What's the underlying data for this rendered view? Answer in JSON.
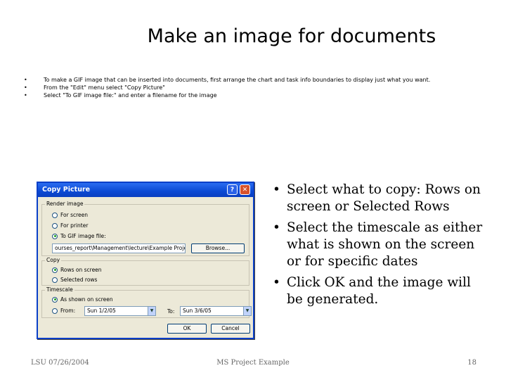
{
  "slide": {
    "title": "Make an image for documents",
    "small_bullets": [
      "To make a GIF image that can be inserted into documents, first arrange the chart and task info boundaries to display just what you want.",
      "From the \"Edit\" menu select \"Copy Picture\"",
      "Select \"To GIF image file:\" and enter a filename for the image"
    ],
    "bullets": [
      "Select what to copy: Rows on screen or Selected Rows",
      "Select the timescale as either what is shown on the screen or for specific dates",
      "Click OK and the image will be generated."
    ],
    "footer": {
      "left": "LSU 07/26/2004",
      "center": "MS Project Example",
      "right": "18"
    }
  },
  "dialog": {
    "title": "Copy Picture",
    "help_glyph": "?",
    "close_glyph": "✕",
    "render_group": "Render image",
    "render_options": [
      "For screen",
      "For printer",
      "To GIF image file:"
    ],
    "gif_path": "ourses_report\\Management\\lecture\\Example Project.gif",
    "browse_label": "Browse...",
    "copy_group": "Copy",
    "copy_options": [
      "Rows on screen",
      "Selected rows"
    ],
    "timescale_group": "Timescale",
    "timescale_options": [
      "As shown on screen",
      "From:"
    ],
    "from_value": "Sun 1/2/05",
    "to_label": "To:",
    "to_value": "Sun 3/6/05",
    "dropdown_glyph": "▼",
    "ok_label": "OK",
    "cancel_label": "Cancel"
  }
}
